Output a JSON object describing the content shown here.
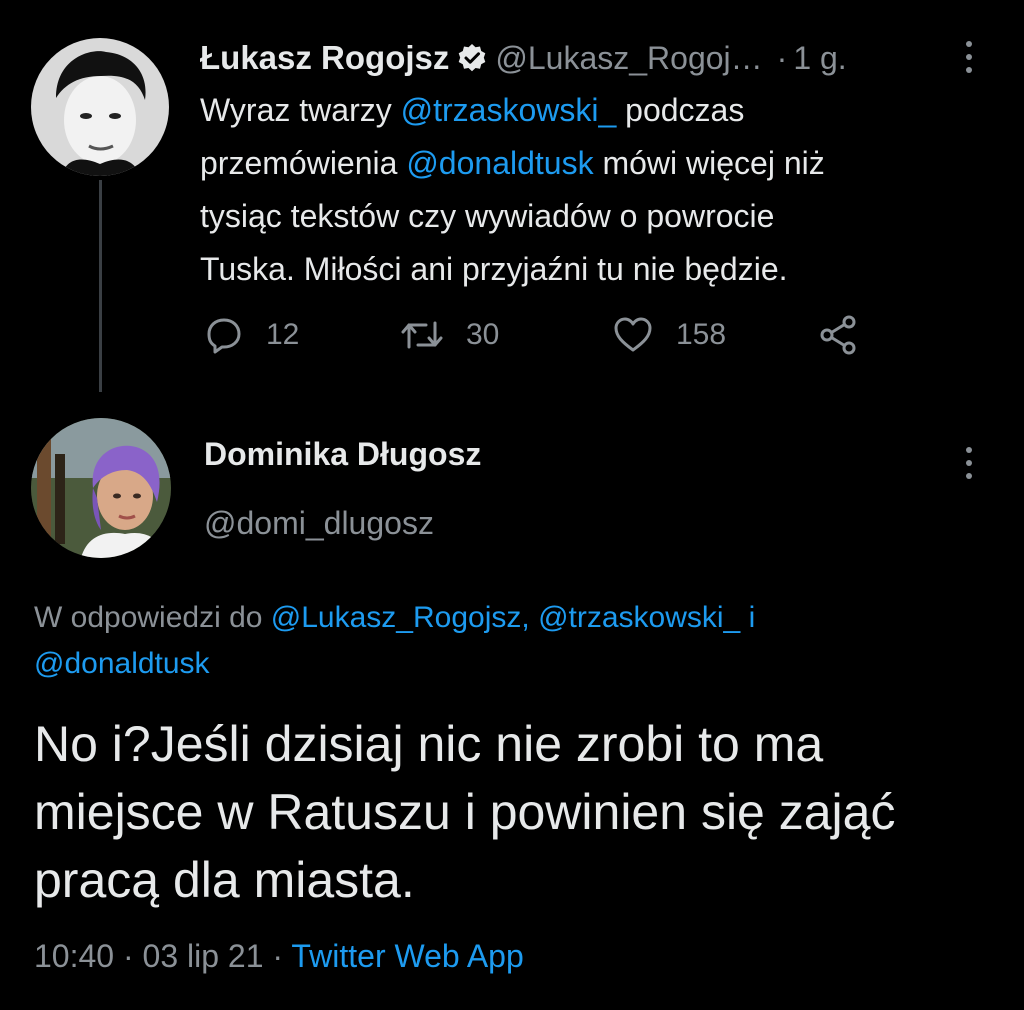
{
  "parent_tweet": {
    "author_name": "Łukasz Rogojsz",
    "author_handle": "@Lukasz_Rogoj…",
    "separator": "·",
    "time_ago": "1 g.",
    "text_parts": [
      {
        "text": "Wyraz twarzy ",
        "type": "text"
      },
      {
        "text": "@trzaskowski_",
        "type": "mention"
      },
      {
        "text": " podczas\nprzemówienia ",
        "type": "text"
      },
      {
        "text": "@donaldtusk",
        "type": "mention"
      },
      {
        "text": " mówi więcej niż\ntysiąc tekstów czy wywiadów o powrocie\nTuska. Miłości ani przyjaźni tu nie będzie.",
        "type": "text"
      }
    ],
    "reply_count": "12",
    "retweet_count": "30",
    "like_count": "158",
    "icons": {
      "verified": "verified-badge-icon",
      "reply": "comment-bubble-icon",
      "retweet": "retweet-arrows-icon",
      "like": "heart-icon",
      "share": "share-nodes-icon",
      "more": "more-vertical-icon"
    }
  },
  "reply_tweet": {
    "author_name": "Dominika Długosz",
    "author_handle": "@domi_dlugosz",
    "replying_prefix": "W odpowiedzi do ",
    "replying_mentions": [
      "@Lukasz_Rogojsz,",
      "@trzaskowski_",
      "i",
      "@donaldtusk"
    ],
    "body": "No i?Jeśli dzisiaj nic nie zrobi to ma miejsce w Ratuszu i powinien się zająć pracą dla miasta.",
    "time": "10:40",
    "date": "03 lip 21",
    "separator": "·",
    "source_app": "Twitter Web App"
  },
  "colors": {
    "background": "#000000",
    "primary_text": "#e7e9ea",
    "secondary_text": "#8b9197",
    "link": "#1d9bf0"
  }
}
